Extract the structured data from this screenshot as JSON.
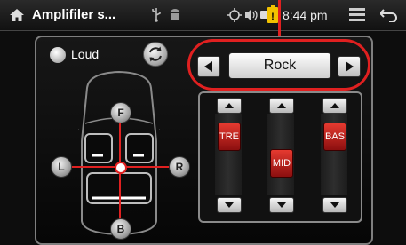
{
  "status_bar": {
    "title": "Amplifiler s...",
    "time": "8:44 pm",
    "icons": [
      "home-icon",
      "usb-icon",
      "android-icon",
      "gps-icon",
      "volume-icon",
      "battery-icon",
      "battery-warning-icon",
      "menu-icon",
      "back-icon"
    ]
  },
  "loud": {
    "label": "Loud"
  },
  "preset": {
    "value": "Rock"
  },
  "fader": {
    "front_label": "F",
    "back_label": "B",
    "left_label": "L",
    "right_label": "R"
  },
  "eq": {
    "bands": [
      {
        "label": "TRE"
      },
      {
        "label": "MID"
      },
      {
        "label": "BAS"
      }
    ]
  },
  "colors": {
    "accent_red": "#e02020",
    "knob_red": "#c2231a",
    "panel_border": "#7f7f7f"
  }
}
